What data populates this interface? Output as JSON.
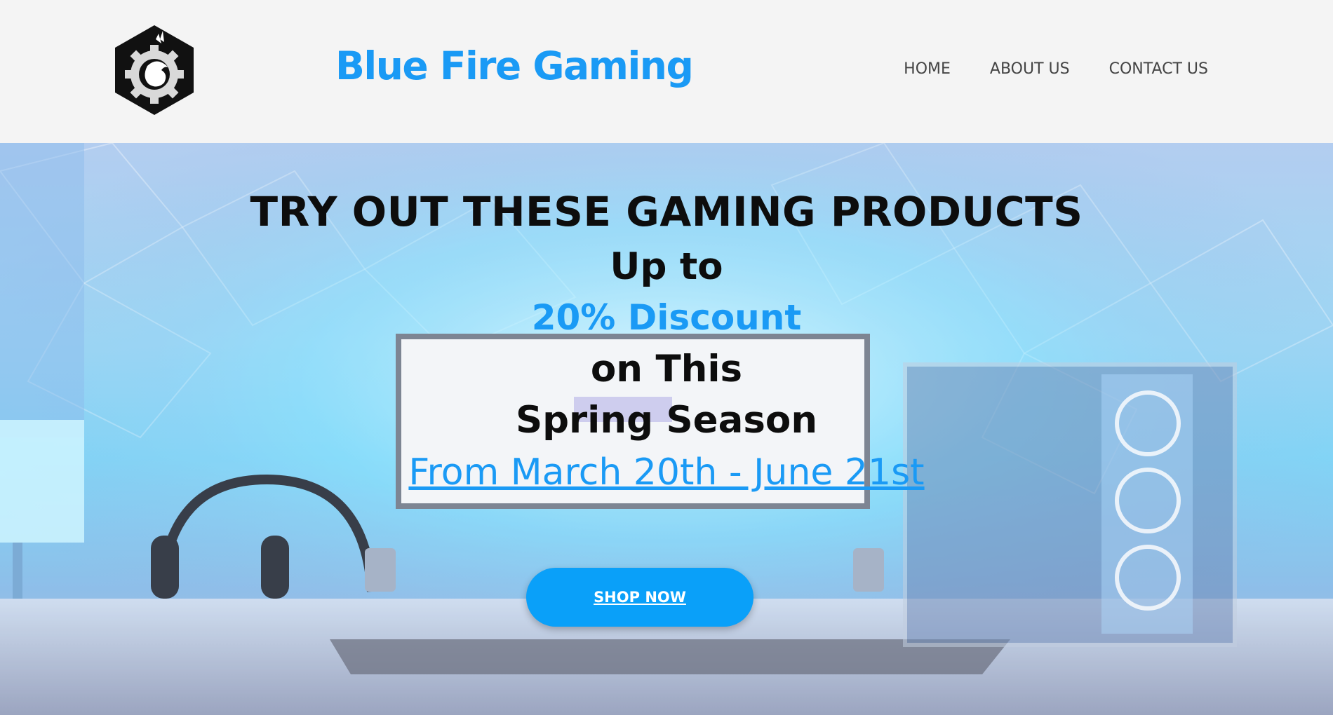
{
  "brand": {
    "name": "Blue Fire Gaming",
    "logo_icon": "dragon-gear-logo-icon",
    "color": "#1a9af5"
  },
  "nav": {
    "items": [
      {
        "label": "HOME"
      },
      {
        "label": "ABOUT US"
      },
      {
        "label": "CONTACT US"
      }
    ]
  },
  "hero": {
    "headline": "TRY OUT THESE GAMING PRODUCTS",
    "line_1": "Up to",
    "line_2": "20% Discount",
    "line_3": "on This",
    "line_4": "Spring Season",
    "dates_link": "From March 20th - June 21st",
    "cta_label": "SHOP NOW",
    "accent_color": "#1a9af5",
    "cta_color": "#0aa0f9"
  }
}
